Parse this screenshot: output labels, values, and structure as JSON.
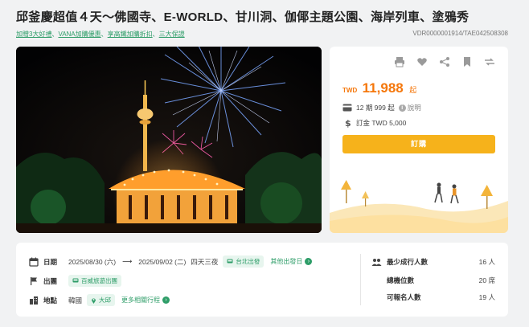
{
  "page": {
    "title": "邱釜慶超值４天～佛國寺、E-WORLD、甘川洞、伽倻主題公園、海岸列車、塗鴉秀",
    "promo_links": [
      "加贈3大好禮",
      "VANA加購優惠",
      "享高鐵加購折扣",
      "三大保證"
    ],
    "promo_sep": "、",
    "codes": "VDR0000001914/TAE042508308"
  },
  "hero": {
    "image_icon": "night-tower-fireworks-carousel-photo"
  },
  "pricing": {
    "icons": [
      "print-icon",
      "heart-icon",
      "share-icon",
      "bookmark-icon",
      "compare-icon"
    ],
    "currency": "TWD",
    "price": "11,988",
    "price_suffix": "起",
    "installment_text": "12 期 999 起",
    "installment_help": "說明",
    "deposit_text": "訂金 TWD 5,000",
    "buy_label": "訂購"
  },
  "details": {
    "date_label": "日期",
    "date_start": "2025/08/30 (六)",
    "date_arrow": "⟶",
    "date_end": "2025/09/02 (二)",
    "duration": "四天三夜",
    "departure_tag": "台北出發",
    "other_departure": "其他出發日",
    "tour_label": "出團",
    "tour_tag": "百威旅遊出團",
    "place_label": "地點",
    "country": "韓國",
    "city_tag": "大邱",
    "more_trips": "更多相關行程"
  },
  "stats": [
    {
      "label": "最少成行人數",
      "value": "16 人"
    },
    {
      "label": "總機位數",
      "value": "20 席"
    },
    {
      "label": "可報名人數",
      "value": "19 人"
    }
  ],
  "colors": {
    "accent_orange": "#f5770b",
    "buy_yellow": "#f6b21b",
    "green": "#2e9d68"
  }
}
